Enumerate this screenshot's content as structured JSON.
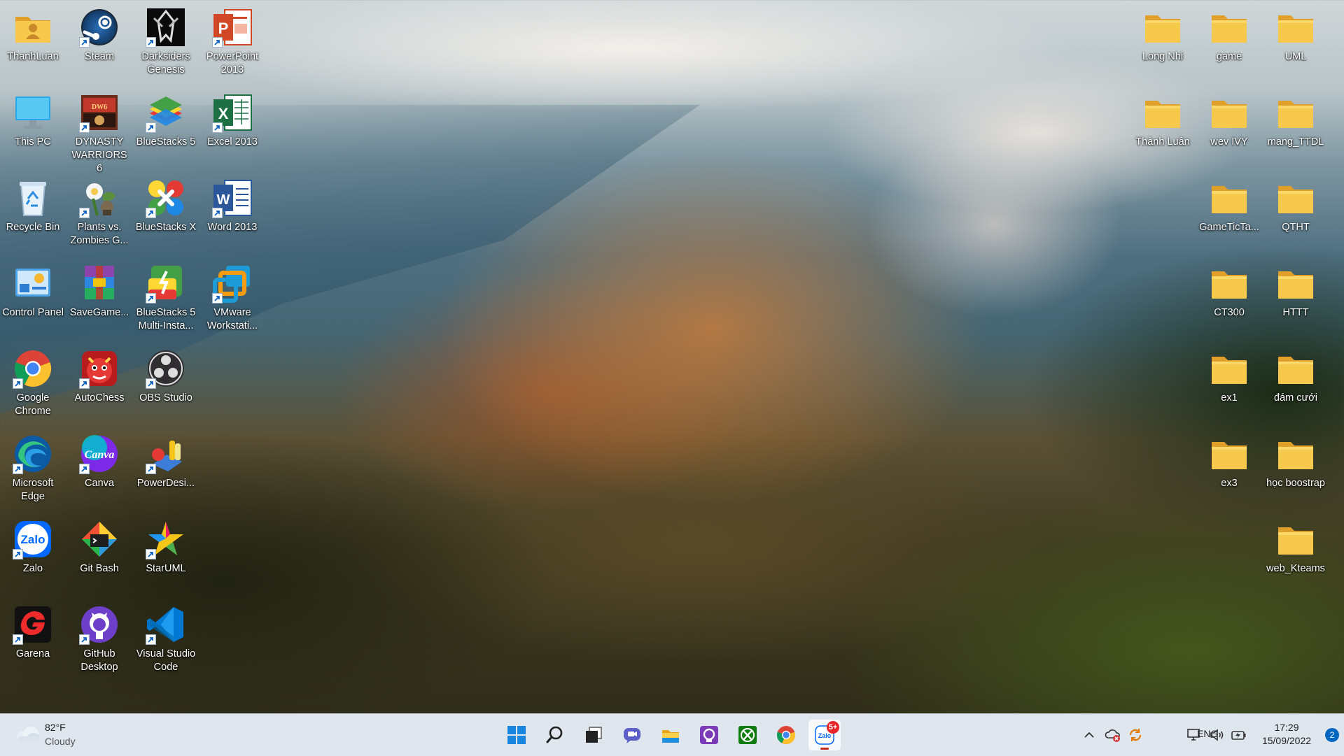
{
  "desktop": {
    "left_icons": [
      {
        "label": "ThanhLuan",
        "icon": "user-folder-icon",
        "col": 0,
        "row": 0,
        "shortcut": false
      },
      {
        "label": "Steam",
        "icon": "steam-icon",
        "col": 1,
        "row": 0,
        "shortcut": true
      },
      {
        "label": "Darksiders Genesis",
        "icon": "darksiders-icon",
        "col": 2,
        "row": 0,
        "shortcut": true
      },
      {
        "label": "PowerPoint 2013",
        "icon": "powerpoint-icon",
        "col": 3,
        "row": 0,
        "shortcut": true
      },
      {
        "label": "This PC",
        "icon": "monitor-icon",
        "col": 0,
        "row": 1,
        "shortcut": false
      },
      {
        "label": "DYNASTY WARRIORS 6",
        "icon": "dynasty-warriors-icon",
        "col": 1,
        "row": 1,
        "shortcut": true
      },
      {
        "label": "BlueStacks 5",
        "icon": "bluestacks-icon",
        "col": 2,
        "row": 1,
        "shortcut": true
      },
      {
        "label": "Excel 2013",
        "icon": "excel-icon",
        "col": 3,
        "row": 1,
        "shortcut": true
      },
      {
        "label": "Recycle Bin",
        "icon": "recycle-bin-icon",
        "col": 0,
        "row": 2,
        "shortcut": false
      },
      {
        "label": "Plants vs. Zombies G...",
        "icon": "plants-vs-zombies-icon",
        "col": 1,
        "row": 2,
        "shortcut": true
      },
      {
        "label": "BlueStacks X",
        "icon": "bluestacks-x-icon",
        "col": 2,
        "row": 2,
        "shortcut": true
      },
      {
        "label": "Word 2013",
        "icon": "word-icon",
        "col": 3,
        "row": 2,
        "shortcut": true
      },
      {
        "label": "Control Panel",
        "icon": "control-panel-icon",
        "col": 0,
        "row": 3,
        "shortcut": false
      },
      {
        "label": "SaveGame...",
        "icon": "winrar-icon",
        "col": 1,
        "row": 3,
        "shortcut": false
      },
      {
        "label": "BlueStacks 5 Multi-Insta...",
        "icon": "bluestacks-multi-icon",
        "col": 2,
        "row": 3,
        "shortcut": true
      },
      {
        "label": "VMware Workstati...",
        "icon": "vmware-icon",
        "col": 3,
        "row": 3,
        "shortcut": true
      },
      {
        "label": "Google Chrome",
        "icon": "chrome-icon",
        "col": 0,
        "row": 4,
        "shortcut": true
      },
      {
        "label": "AutoChess",
        "icon": "autochess-icon",
        "col": 1,
        "row": 4,
        "shortcut": true
      },
      {
        "label": "OBS Studio",
        "icon": "obs-icon",
        "col": 2,
        "row": 4,
        "shortcut": true
      },
      {
        "label": "Microsoft Edge",
        "icon": "edge-icon",
        "col": 0,
        "row": 5,
        "shortcut": true
      },
      {
        "label": "Canva",
        "icon": "canva-icon",
        "col": 1,
        "row": 5,
        "shortcut": true
      },
      {
        "label": "PowerDesi...",
        "icon": "powerdesigner-icon",
        "col": 2,
        "row": 5,
        "shortcut": true
      },
      {
        "label": "Zalo",
        "icon": "zalo-icon",
        "col": 0,
        "row": 6,
        "shortcut": true
      },
      {
        "label": "Git Bash",
        "icon": "git-bash-icon",
        "col": 1,
        "row": 6,
        "shortcut": false
      },
      {
        "label": "StarUML",
        "icon": "staruml-icon",
        "col": 2,
        "row": 6,
        "shortcut": true
      },
      {
        "label": "Garena",
        "icon": "garena-icon",
        "col": 0,
        "row": 7,
        "shortcut": true
      },
      {
        "label": "GitHub Desktop",
        "icon": "github-desktop-icon",
        "col": 1,
        "row": 7,
        "shortcut": true
      },
      {
        "label": "Visual Studio Code",
        "icon": "vscode-icon",
        "col": 2,
        "row": 7,
        "shortcut": true
      }
    ],
    "right_folders": [
      {
        "label": "Long Nhi",
        "col": 0,
        "row": 0
      },
      {
        "label": "game",
        "col": 1,
        "row": 0
      },
      {
        "label": "UML",
        "col": 2,
        "row": 0
      },
      {
        "label": "Thành Luân",
        "col": 0,
        "row": 1
      },
      {
        "label": "wev IVY",
        "col": 1,
        "row": 1
      },
      {
        "label": "mang_TTDL",
        "col": 2,
        "row": 1
      },
      {
        "label": "GameTicTa...",
        "col": 1,
        "row": 2
      },
      {
        "label": "QTHT",
        "col": 2,
        "row": 2
      },
      {
        "label": "CT300",
        "col": 1,
        "row": 3
      },
      {
        "label": "HTTT",
        "col": 2,
        "row": 3
      },
      {
        "label": "ex1",
        "col": 1,
        "row": 4
      },
      {
        "label": "đám cưới",
        "col": 2,
        "row": 4
      },
      {
        "label": "ex3",
        "col": 1,
        "row": 5
      },
      {
        "label": "học boostrap",
        "col": 2,
        "row": 5
      },
      {
        "label": "web_Kteams",
        "col": 2,
        "row": 6
      }
    ]
  },
  "taskbar": {
    "weather": {
      "temp": "82°F",
      "condition": "Cloudy",
      "icon": "cloud-icon"
    },
    "pinned": [
      {
        "name": "start",
        "icon": "windows-start-icon"
      },
      {
        "name": "search",
        "icon": "search-icon"
      },
      {
        "name": "task-view",
        "icon": "task-view-icon"
      },
      {
        "name": "chat",
        "icon": "teams-chat-icon"
      },
      {
        "name": "file-explorer",
        "icon": "folder-icon"
      },
      {
        "name": "app-purple",
        "icon": "purple-app-icon"
      },
      {
        "name": "xbox",
        "icon": "xbox-icon"
      },
      {
        "name": "chrome",
        "icon": "chrome-icon"
      },
      {
        "name": "zalo",
        "icon": "zalo-icon",
        "badge": "5+",
        "active": true
      }
    ],
    "tray": {
      "language": "ENG",
      "time": "17:29",
      "date": "15/09/2022",
      "notifications": "2"
    }
  },
  "colors": {
    "taskbar_bg": "#dfe6ee",
    "folder_yellow": "#f6c84c",
    "badge_red": "#e8262a",
    "notif_blue": "#0067c0"
  }
}
